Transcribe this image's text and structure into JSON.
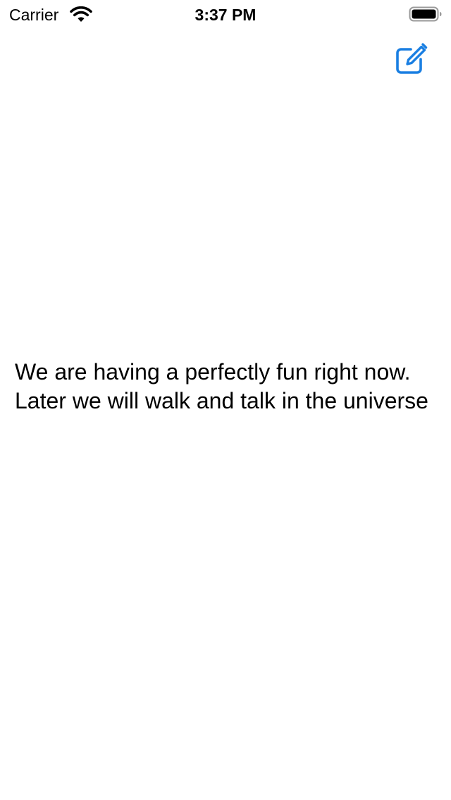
{
  "status_bar": {
    "carrier": "Carrier",
    "time": "3:37 PM",
    "wifi_icon": "wifi-icon",
    "battery_icon": "battery-icon"
  },
  "toolbar": {
    "compose_icon": "compose-icon",
    "accent_color": "#1a7fe2"
  },
  "main": {
    "message": "We are having a perfectly fun right now. Later we will walk and talk in the universe"
  }
}
